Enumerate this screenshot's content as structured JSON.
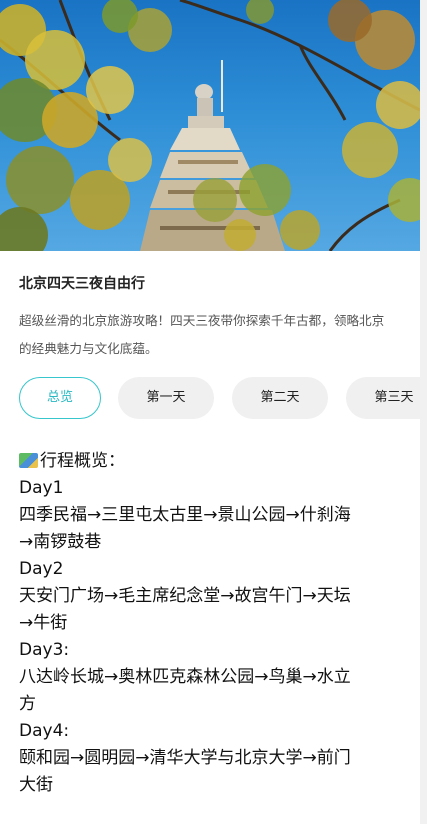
{
  "header": {
    "image_alt": "pagoda under ginkgo branches"
  },
  "article": {
    "title": "北京四天三夜自由行",
    "description_line1": "超级丝滑的北京旅游攻略！四天三夜带你探索千年古都，领略北京",
    "description_line2": "的经典魅力与文化底蕴。"
  },
  "tabs": [
    {
      "label": "总览",
      "active": true
    },
    {
      "label": "第一天",
      "active": false
    },
    {
      "label": "第二天",
      "active": false
    },
    {
      "label": "第三天",
      "active": false
    }
  ],
  "overview": {
    "heading_icon": "map-icon",
    "heading": "行程概览：",
    "day1_label": "Day1",
    "day1_route_a": "四季民福→三里屯太古里→景山公园→什刹海",
    "day1_route_b": "→南锣鼓巷",
    "day2_label": "Day2",
    "day2_route_a": "天安门广场→毛主席纪念堂→故宫午门→天坛",
    "day2_route_b": "→牛街",
    "day3_label": "Day3:",
    "day3_route_a": "八达岭长城→奥林匹克森林公园→鸟巢→水立",
    "day3_route_b": "方",
    "day4_label": "Day4:",
    "day4_route_a": "颐和园→圆明园→清华大学与北京大学→前门",
    "day4_route_b": "大街"
  },
  "colors": {
    "accent": "#36c6cc",
    "tab_bg": "#f0f0f0",
    "sky": "#2d8ed6",
    "leaf": "#c9a92c"
  }
}
